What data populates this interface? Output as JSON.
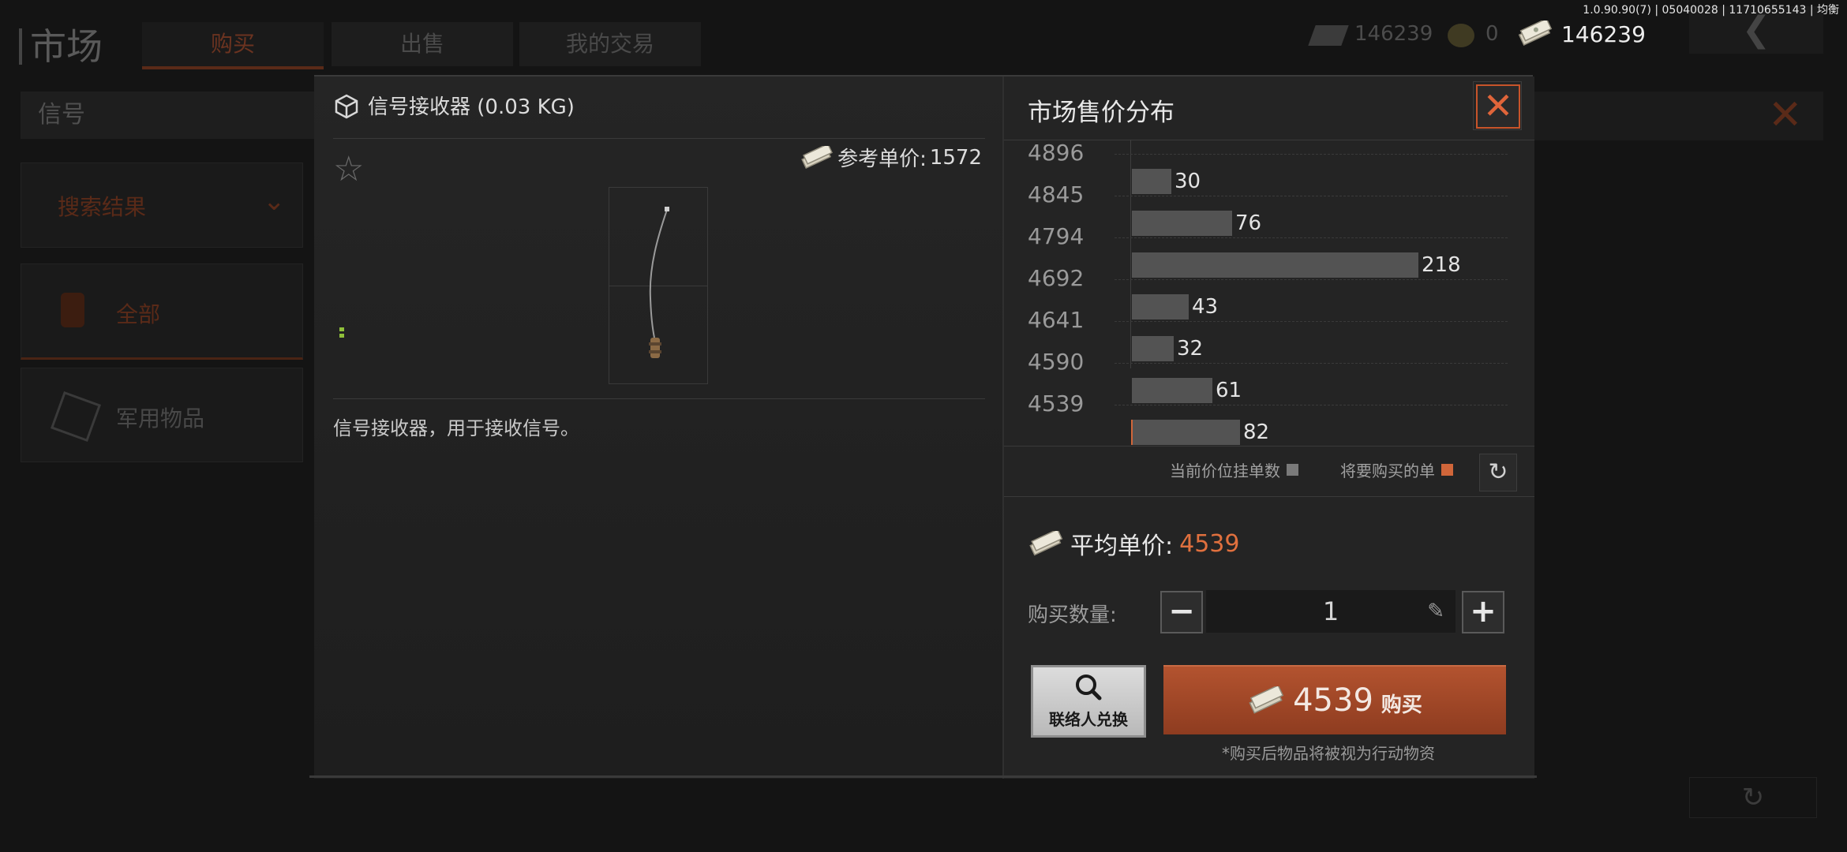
{
  "version_info": "1.0.90.90(7) | 05040028 | 11710655143 | 均衡",
  "background": {
    "title": "市场",
    "tabs": [
      "购买",
      "出售",
      "我的交易"
    ],
    "search_text": "信号",
    "filter_label": "搜索结果",
    "categories": [
      "全部",
      "军用物品"
    ],
    "currency_1": "146239",
    "currency_2": "0"
  },
  "top_money": "146239",
  "item": {
    "name": "信号接收器 (0.03 KG)",
    "reference_price_label": "参考单价:",
    "reference_price": "1572",
    "description": "信号接收器，用于接收信号。"
  },
  "market": {
    "title": "市场售价分布",
    "close_symbol": "✕",
    "legend_current": "当前价位挂单数",
    "legend_buying": "将要购买的单",
    "avg_price_label": "平均单价:",
    "avg_price": "4539",
    "qty_label": "购买数量:",
    "qty_value": "1",
    "qty_minus": "−",
    "qty_plus": "+",
    "contact_button": "联络人兑换",
    "buy_price": "4539",
    "buy_label": "购买",
    "note": "*购买后物品将被视为行动物资"
  },
  "colors": {
    "accent": "#e0703e",
    "bar": "#535353",
    "buying_marker": "#d0663a"
  },
  "chart_data": {
    "type": "bar",
    "orientation": "horizontal",
    "title": "市场售价分布",
    "y_tick_labels": [
      "4896",
      "4845",
      "4794",
      "4692",
      "4641",
      "4590",
      "4539"
    ],
    "values": [
      30,
      76,
      218,
      43,
      32,
      61,
      82
    ],
    "xlim": [
      0,
      245
    ],
    "legend": [
      "当前价位挂单数",
      "将要购买的单"
    ]
  }
}
